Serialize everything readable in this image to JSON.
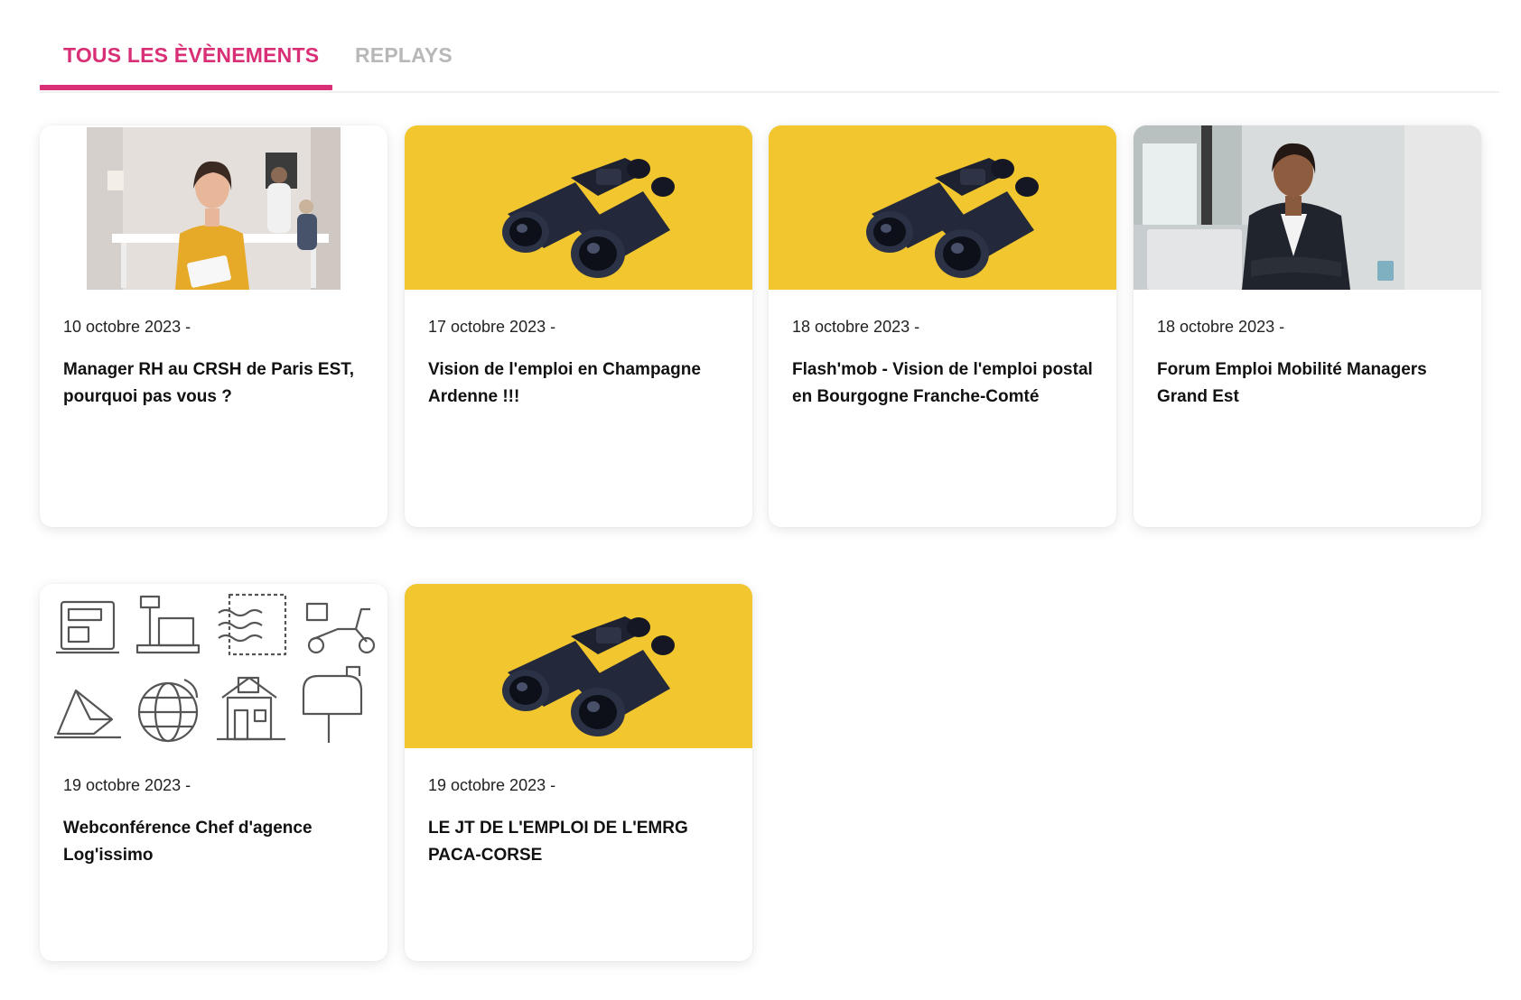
{
  "tabs": [
    {
      "label": "TOUS LES ÈVÈNEMENTS",
      "active": true
    },
    {
      "label": "REPLAYS",
      "active": false
    }
  ],
  "accent_color": "#d92f76",
  "events": [
    {
      "date": "10 octobre 2023 -",
      "title": "Manager RH au CRSH de Paris EST, pourquoi pas vous ?",
      "image": "woman-office-photo"
    },
    {
      "date": "17 octobre 2023 -",
      "title": "Vision de l'emploi en Champagne Ardenne !!!",
      "image": "binoculars-yellow"
    },
    {
      "date": "18 octobre 2023 -",
      "title": "Flash'mob - Vision de l'emploi postal en Bourgogne Franche-Comté",
      "image": "binoculars-yellow"
    },
    {
      "date": "18 octobre 2023 -",
      "title": "Forum Emploi Mobilité Managers Grand Est",
      "image": "businesswoman-photo"
    },
    {
      "date": "19 octobre 2023 -",
      "title": "Webconférence Chef d'agence Log'issimo",
      "image": "postal-icons-grid"
    },
    {
      "date": "19 octobre 2023 -",
      "title": "LE JT DE L'EMPLOI DE L'EMRG PACA-CORSE",
      "image": "binoculars-yellow"
    }
  ],
  "colors": {
    "binoculars_bg": "#f2c62f",
    "active_tab": "#d92f76",
    "inactive_tab": "#b8b8b8"
  }
}
